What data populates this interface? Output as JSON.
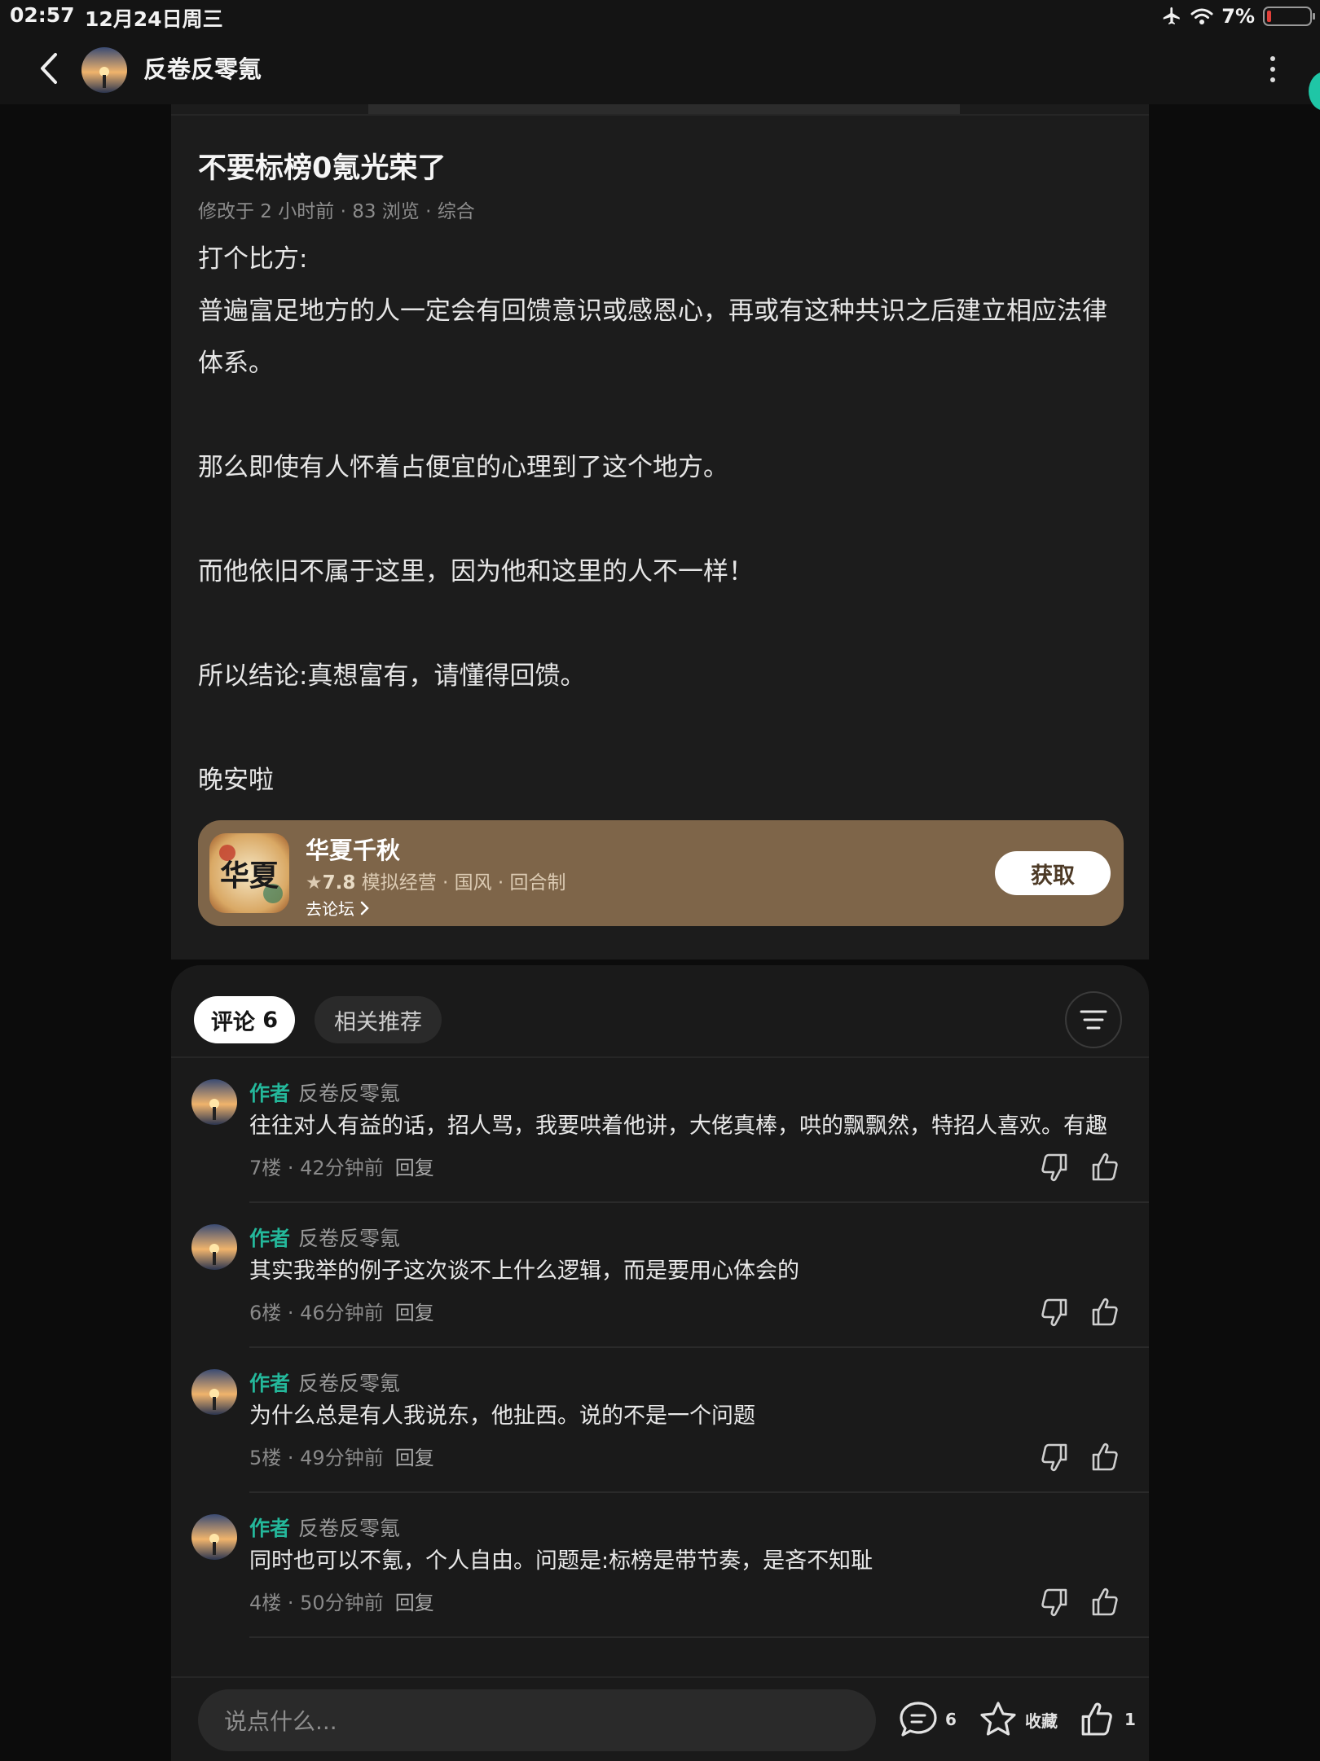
{
  "status_bar": {
    "time": "02:57",
    "date": "12月24日周三",
    "battery": "7%"
  },
  "nav": {
    "title": "反卷反零氪"
  },
  "post": {
    "title": "不要标榜0氪光荣了",
    "meta": "修改于 2 小时前 · 83 浏览 · 综合",
    "paragraphs": [
      "打个比方:",
      "普遍富足地方的人一定会有回馈意识或感恩心，再或有这种共识之后建立相应法律体系。",
      "",
      "那么即使有人怀着占便宜的心理到了这个地方。",
      "",
      "而他依旧不属于这里，因为他和这里的人不一样！",
      "",
      "所以结论:真想富有，请懂得回馈。",
      "",
      "晚安啦"
    ]
  },
  "app_card": {
    "icon_text": "华夏",
    "name": "华夏千秋",
    "rating": "7.8",
    "tags": "模拟经营 · 国风 · 回合制",
    "forum_link": "去论坛",
    "get_button": "获取"
  },
  "tabs": {
    "comments": "评论",
    "comments_count": "6",
    "related": "相关推荐"
  },
  "comments": [
    {
      "badge": "作者",
      "user": "反卷反零氪",
      "text": "往往对人有益的话，招人骂，我要哄着他讲，大佬真棒，哄的飘飘然，特招人喜欢。有趣",
      "meta": "7楼 · 42分钟前",
      "reply": "回复"
    },
    {
      "badge": "作者",
      "user": "反卷反零氪",
      "text": "其实我举的例子这次谈不上什么逻辑，而是要用心体会的",
      "meta": "6楼 · 46分钟前",
      "reply": "回复"
    },
    {
      "badge": "作者",
      "user": "反卷反零氪",
      "text": "为什么总是有人我说东，他扯西。说的不是一个问题",
      "meta": "5楼 · 49分钟前",
      "reply": "回复"
    },
    {
      "badge": "作者",
      "user": "反卷反零氪",
      "text": "同时也可以不氪，个人自由。问题是:标榜是带节奏，是吝不知耻",
      "meta": "4楼 · 50分钟前",
      "reply": "回复"
    }
  ],
  "bottom_bar": {
    "input_placeholder": "说点什么...",
    "comment_count": "6",
    "favorite_label": "收藏",
    "like_count": "1"
  },
  "colors": {
    "author_badge": "#24b89b",
    "app_card_bg": "#7e6549",
    "accent_teal": "#1fc6a6"
  },
  "icons": [
    "back-icon",
    "more-icon",
    "airplane-icon",
    "wifi-icon",
    "battery-icon",
    "star-icon",
    "chevron-right-icon",
    "sort-icon",
    "thumbs-down-icon",
    "thumbs-up-icon",
    "comment-icon",
    "favorite-star-icon"
  ]
}
